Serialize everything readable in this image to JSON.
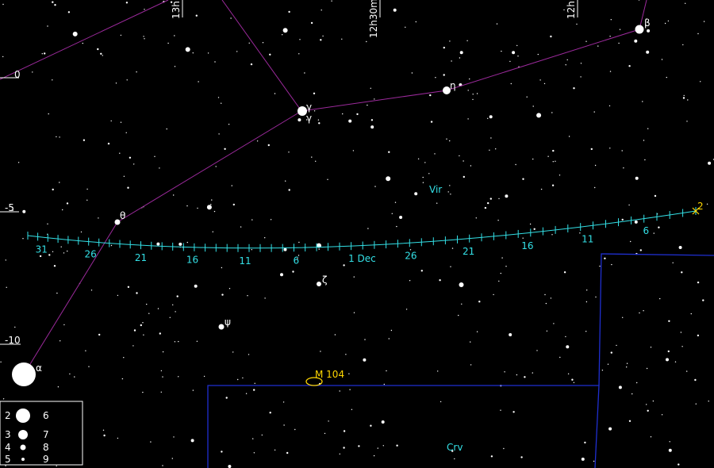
{
  "ra_labels": [
    "13h",
    "12h30m",
    "12h"
  ],
  "dec_labels": [
    "0",
    "-5",
    "-10"
  ],
  "constellations": {
    "virgo": "Vir",
    "corvus": "Crv"
  },
  "object": {
    "name": "M 104"
  },
  "greek": {
    "beta": "β",
    "eta": "η",
    "gamma": "γ",
    "gamma2": "γ",
    "theta": "θ",
    "zeta": "ζ",
    "psi": "ψ",
    "alpha": "α"
  },
  "track": {
    "end_label": "2",
    "date_labels": [
      "31",
      "26",
      "21",
      "16",
      "11",
      "6",
      "1 Dec",
      "26",
      "21",
      "16",
      "11",
      "6"
    ]
  },
  "legend": {
    "mag_left": [
      "2",
      "3",
      "4",
      "5"
    ],
    "mag_right": [
      "6",
      "7",
      "8",
      "9"
    ]
  },
  "colors": {
    "constellation_line": "#9c2a9c",
    "boundary_line": "#1f2fd0",
    "track": "#33e0e6",
    "object": "#ffd700",
    "grid": "#ffffff",
    "background": "#000000"
  }
}
